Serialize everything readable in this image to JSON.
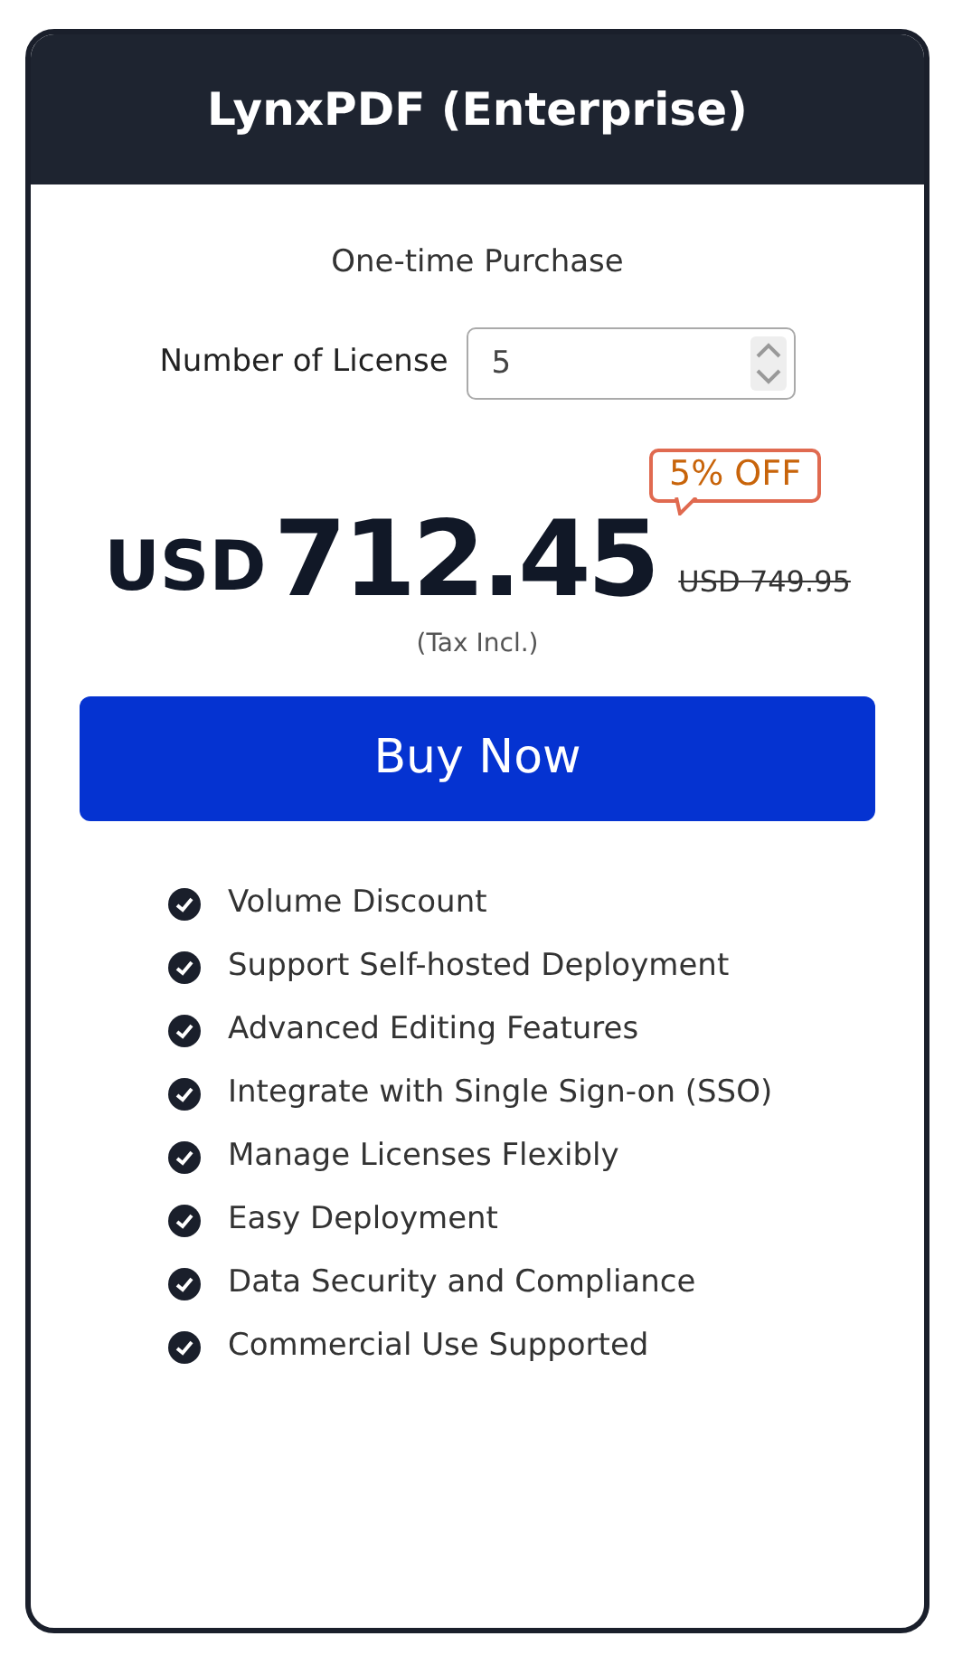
{
  "header": {
    "title": "LynxPDF (Enterprise)"
  },
  "purchase_type": "One-time Purchase",
  "license": {
    "label": "Number of License",
    "value": "5"
  },
  "discount_badge": "5% OFF",
  "price": {
    "currency": "USD",
    "amount": "712.45",
    "original": "USD 749.95",
    "tax_note": "(Tax Incl.)"
  },
  "buy_button": "Buy Now",
  "features": [
    "Volume Discount",
    "Support Self-hosted Deployment",
    "Advanced Editing Features",
    "Integrate with Single Sign-on (SSO)",
    "Manage Licenses Flexibly",
    "Easy Deployment",
    "Data Security and Compliance",
    "Commercial Use Supported"
  ]
}
